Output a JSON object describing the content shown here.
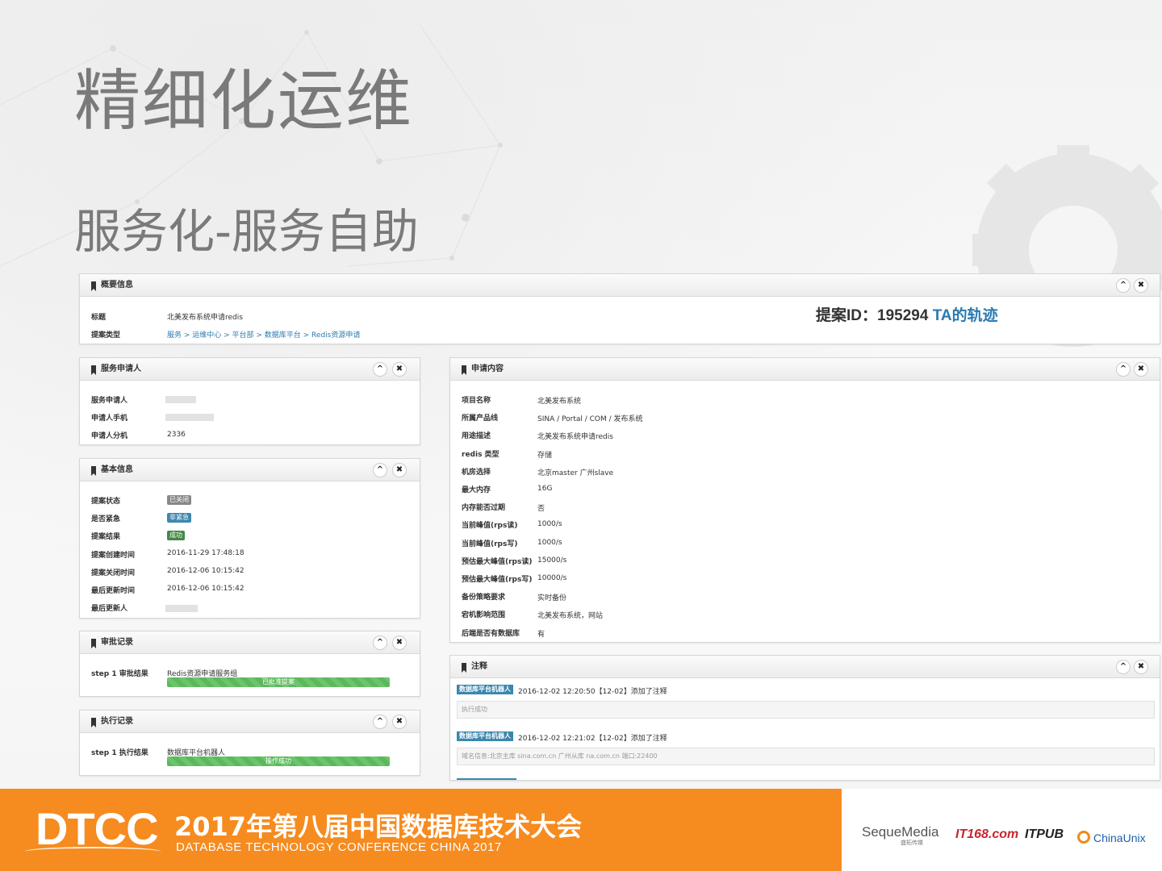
{
  "slide": {
    "title": "精细化运维",
    "subtitle": "服务化-服务自助"
  },
  "proposal": {
    "id_label": "提案ID：195294",
    "trail_link": "TA的轨迹"
  },
  "overview": {
    "heading": "概要信息",
    "rows": [
      {
        "label": "标题",
        "value": "北美发布系统申请redis"
      },
      {
        "label": "提案类型",
        "value": "服务 > 运维中心 > 平台部 > 数据库平台 > Redis资源申请"
      }
    ]
  },
  "applicant": {
    "heading": "服务申请人",
    "rows": [
      {
        "label": "服务申请人",
        "value": ""
      },
      {
        "label": "申请人手机",
        "value": ""
      },
      {
        "label": "申请人分机",
        "value": "2336"
      }
    ]
  },
  "basic": {
    "heading": "基本信息",
    "rows": [
      {
        "label": "提案状态",
        "value": "已关闭",
        "color": "#888888"
      },
      {
        "label": "是否紧急",
        "value": "非紧急",
        "color": "#3a87ad"
      },
      {
        "label": "提案结果",
        "value": "成功",
        "color": "#468847"
      },
      {
        "label": "提案创建时间",
        "value": "2016-11-29 17:48:18"
      },
      {
        "label": "提案关闭时间",
        "value": "2016-12-06 10:15:42"
      },
      {
        "label": "最后更新时间",
        "value": "2016-12-06 10:15:42"
      },
      {
        "label": "最后更新人",
        "value": ""
      }
    ]
  },
  "approval": {
    "heading": "审批记录",
    "label": "step 1 审批结果",
    "value": "Redis资源申请服务组",
    "bar_text": "已批准提案",
    "progress": 1.0
  },
  "execution": {
    "heading": "执行记录",
    "label": "step 1 执行结果",
    "value": "数据库平台机器人",
    "bar_text": "操作成功",
    "progress": 1.0
  },
  "request": {
    "heading": "申请内容",
    "rows": [
      {
        "label": "项目名称",
        "value": "北美发布系统"
      },
      {
        "label": "所属产品线",
        "value": "SINA / Portal / COM / 发布系统"
      },
      {
        "label": "用途描述",
        "value": "北美发布系统申请redis"
      },
      {
        "label": "redis 类型",
        "value": "存储"
      },
      {
        "label": "机房选择",
        "value": "北京master 广州slave"
      },
      {
        "label": "最大内存",
        "value": "16G"
      },
      {
        "label": "内存能否过期",
        "value": "否"
      },
      {
        "label": "当前峰值(rps读)",
        "value": "1000/s"
      },
      {
        "label": "当前峰值(rps写)",
        "value": "1000/s"
      },
      {
        "label": "预估最大峰值(rps读)",
        "value": "15000/s"
      },
      {
        "label": "预估最大峰值(rps写)",
        "value": "10000/s"
      },
      {
        "label": "备份策略要求",
        "value": "实时备份"
      },
      {
        "label": "宕机影响范围",
        "value": "北美发布系统，网站"
      },
      {
        "label": "后端是否有数据库",
        "value": "有"
      }
    ]
  },
  "notes": {
    "heading": "注释",
    "items": [
      {
        "tag": "数据库平台机器人",
        "meta": "2016-12-02 12:20:50【12-02】添加了注释",
        "body": "执行成功"
      },
      {
        "tag": "数据库平台机器人",
        "meta": "2016-12-02 12:21:02【12-02】添加了注释",
        "body": "域名信息:北京主库                              sina.com.cn 广州从库                              na.com.cn 端口:22400"
      }
    ]
  },
  "controls": {
    "collapse": "^",
    "close": "✖"
  },
  "footer": {
    "logo": "DTCC",
    "title": "2017年第八届中国数据库技术大会",
    "subtitle": "DATABASE  TECHNOLOGY  CONFERENCE CHINA 2017",
    "sponsors": [
      "SequeMedia",
      "盛拓传媒",
      "IT168.com",
      "ITPUB",
      "ChinaUnix"
    ]
  },
  "colors": {
    "accent": "#f68b1f",
    "link": "#2a7ab0",
    "success": "#5cb85c"
  }
}
